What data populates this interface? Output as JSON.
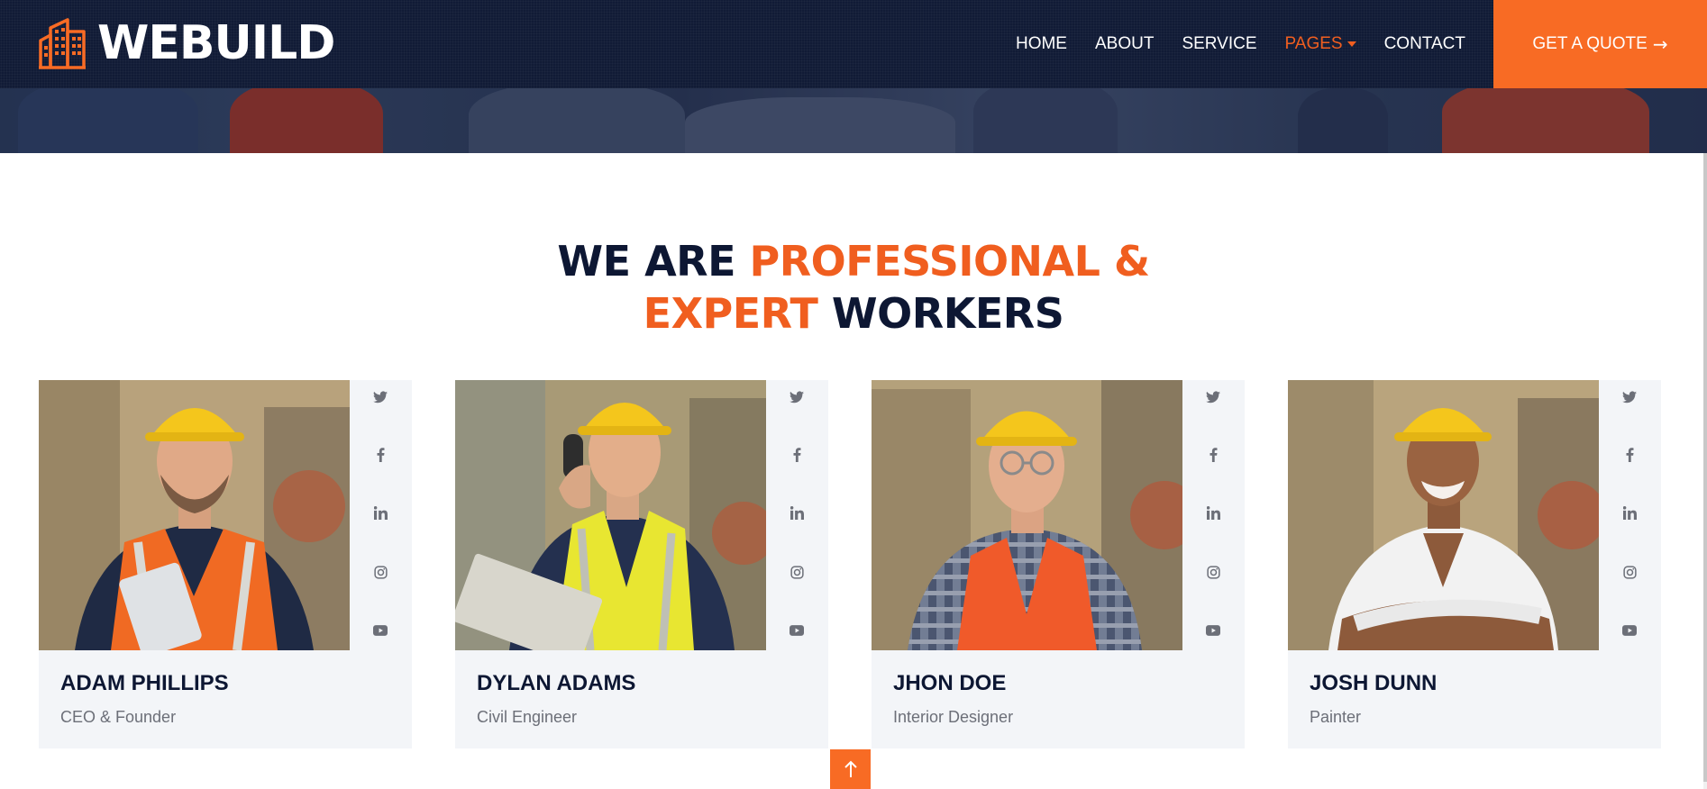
{
  "brand": {
    "name": "WEBUILD",
    "logo_icon": "building-icon"
  },
  "nav": {
    "items": [
      {
        "label": "HOME",
        "active": false
      },
      {
        "label": "ABOUT",
        "active": false
      },
      {
        "label": "SERVICE",
        "active": false
      },
      {
        "label": "PAGES",
        "active": true,
        "dropdown": true
      },
      {
        "label": "CONTACT",
        "active": false
      }
    ],
    "quote_label": "GET A QUOTE",
    "quote_icon": "arrow-right-icon"
  },
  "section": {
    "title_line1_dark": "WE ARE ",
    "title_line1_accent": "PROFESSIONAL &",
    "title_line2_accent": "EXPERT",
    "title_line2_dark": " WORKERS"
  },
  "team": [
    {
      "name": "ADAM PHILLIPS",
      "role": "CEO & Founder"
    },
    {
      "name": "DYLAN ADAMS",
      "role": "Civil Engineer"
    },
    {
      "name": "JHON DOE",
      "role": "Interior Designer"
    },
    {
      "name": "JOSH DUNN",
      "role": "Painter"
    }
  ],
  "social_icons": [
    "twitter-icon",
    "facebook-icon",
    "linkedin-icon",
    "instagram-icon",
    "youtube-icon"
  ],
  "back_to_top_icon": "arrow-up-icon",
  "colors": {
    "navy": "#111b36",
    "accent": "#f86b24",
    "accent_text": "#f05e1f",
    "card_bg": "#f3f5f8",
    "role_text": "#6c6f78"
  }
}
